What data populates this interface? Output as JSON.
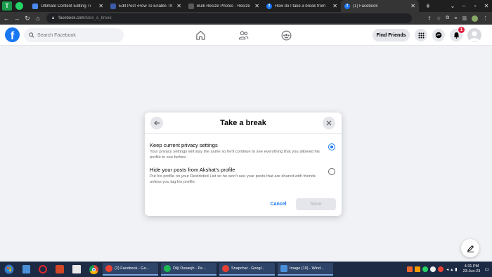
{
  "browser": {
    "tabs": [
      {
        "title": "Ultimate Content Editing Ti",
        "favicon_color": "#4a8af4"
      },
      {
        "title": "Edit Post ‹How To Enable Th",
        "favicon_color": "#3c5ba8"
      },
      {
        "title": "Bulk Resize Photos · Resize",
        "favicon_color": "#5a5a5a"
      },
      {
        "title": "How do I take a break from",
        "favicon_color": "#1877f2"
      },
      {
        "title": "(1) Facebook",
        "favicon_color": "#1877f2"
      }
    ],
    "active_tab_index": 4,
    "url_host": "facebook.com",
    "url_path": "/take_a_break"
  },
  "facebook": {
    "search_placeholder": "Search Facebook",
    "find_friends_label": "Find Friends",
    "notification_count": "1"
  },
  "modal": {
    "title": "Take a break",
    "options": [
      {
        "title": "Keep current privacy settings",
        "description": "Your privacy settings will stay the same so he'll continue to see everything that you allowed his profile to see before.",
        "selected": true
      },
      {
        "title": "Hide your posts from Akshat's profile",
        "description": "Put his profile on your Restricted List so he won't see your posts that are shared with friends unless you tag his profile.",
        "selected": false
      }
    ],
    "cancel_label": "Cancel",
    "save_label": "Save"
  },
  "taskbar": {
    "apps": [
      {
        "label": "(2) Facebook - Go...",
        "color": "#e94235"
      },
      {
        "label": "Dilji Dosanjh - Pe...",
        "color": "#1db954"
      },
      {
        "label": "Snapchat - Googl...",
        "color": "#e94235"
      },
      {
        "label": "Image (10) - Wind...",
        "color": "#4a90d9"
      }
    ],
    "time": "4:31 PM",
    "date": "23-Jun-23"
  },
  "colors": {
    "facebook_blue": "#1877f2",
    "page_bg": "#f0f2f5"
  }
}
